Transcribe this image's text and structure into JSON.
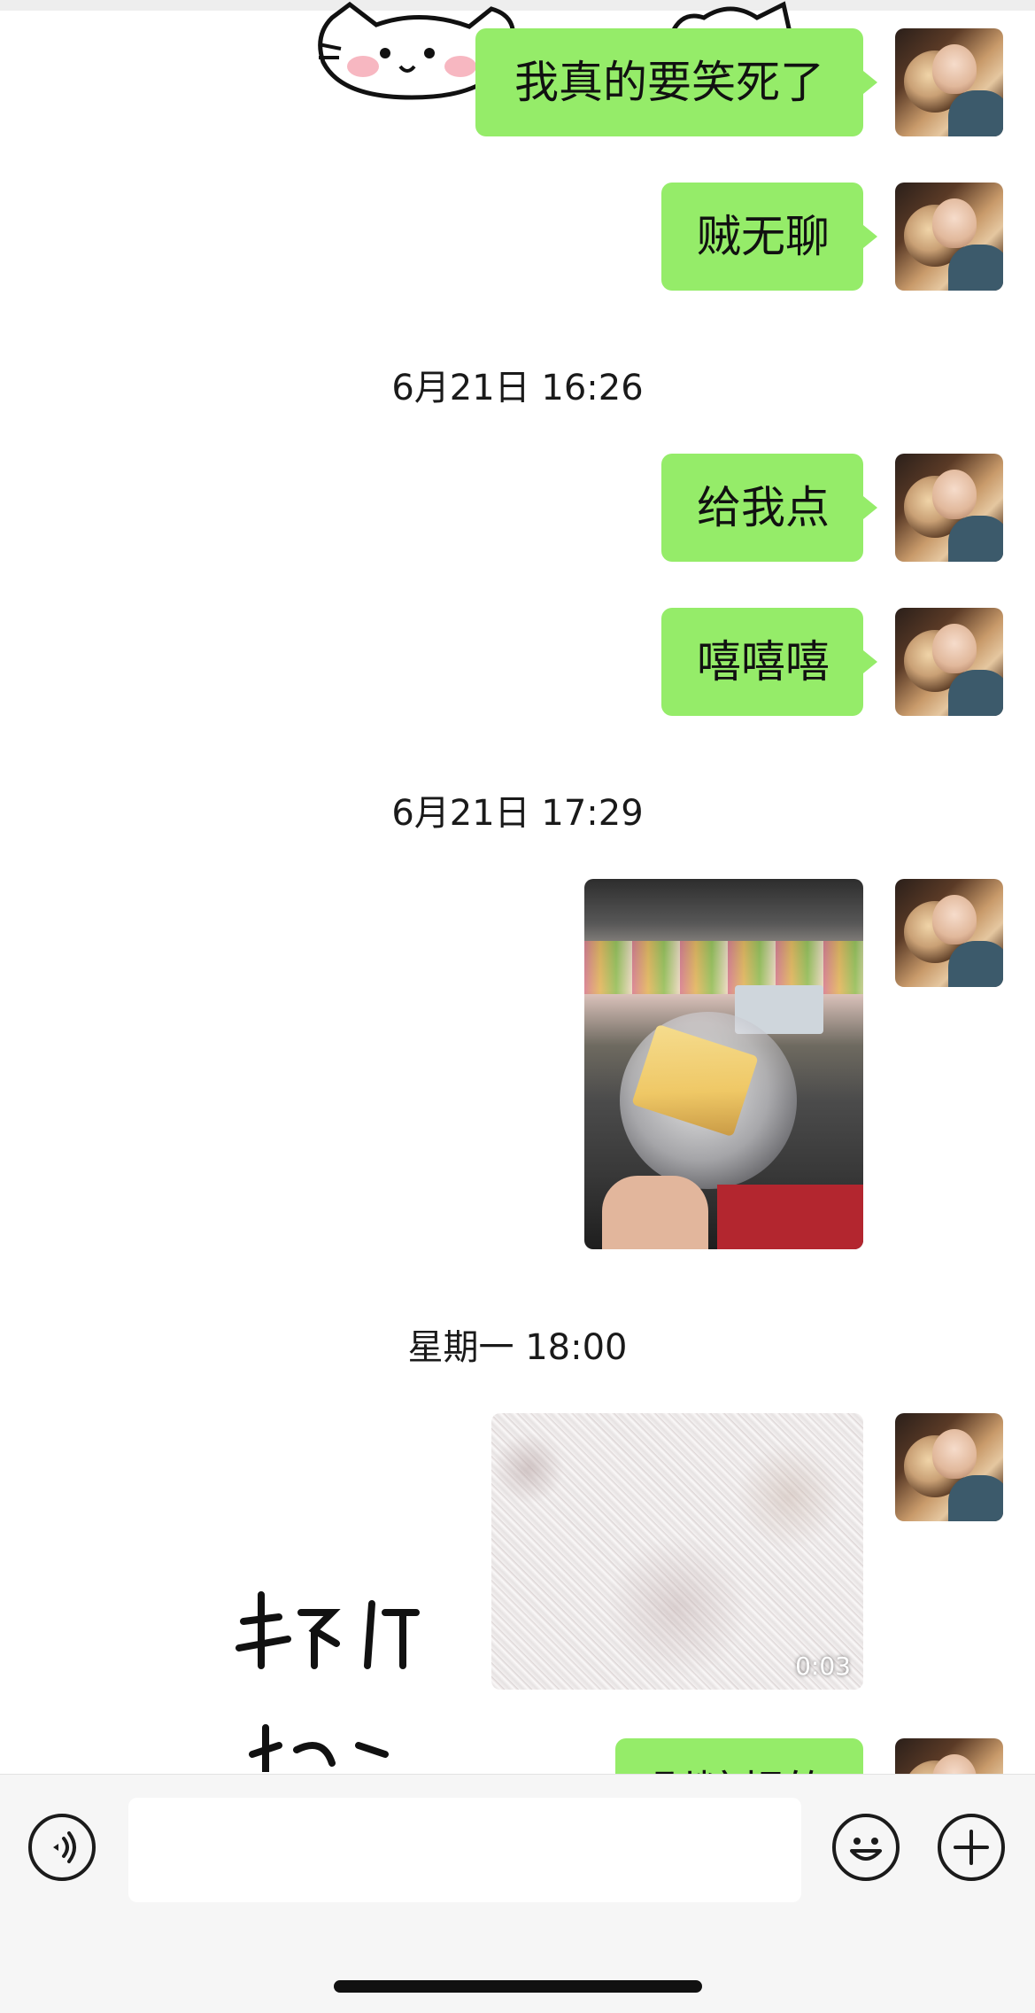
{
  "chat": {
    "messages": [
      {
        "text": "我真的要笑死了"
      },
      {
        "text": "贼无聊"
      },
      {
        "text": "给我点"
      },
      {
        "text": "嘻嘻嘻"
      },
      {
        "text": "剥糖超的"
      }
    ],
    "timestamps": [
      "6月21日 16:26",
      "6月21日 17:29",
      "星期一 18:00"
    ],
    "video_duration": "0:03"
  },
  "input_bar": {
    "placeholder": "",
    "icons": [
      "voice-icon",
      "emoji-icon",
      "plus-icon"
    ]
  },
  "colors": {
    "bubble": "#95ec69",
    "background": "#ffffff",
    "input_bar": "#f6f6f6"
  }
}
